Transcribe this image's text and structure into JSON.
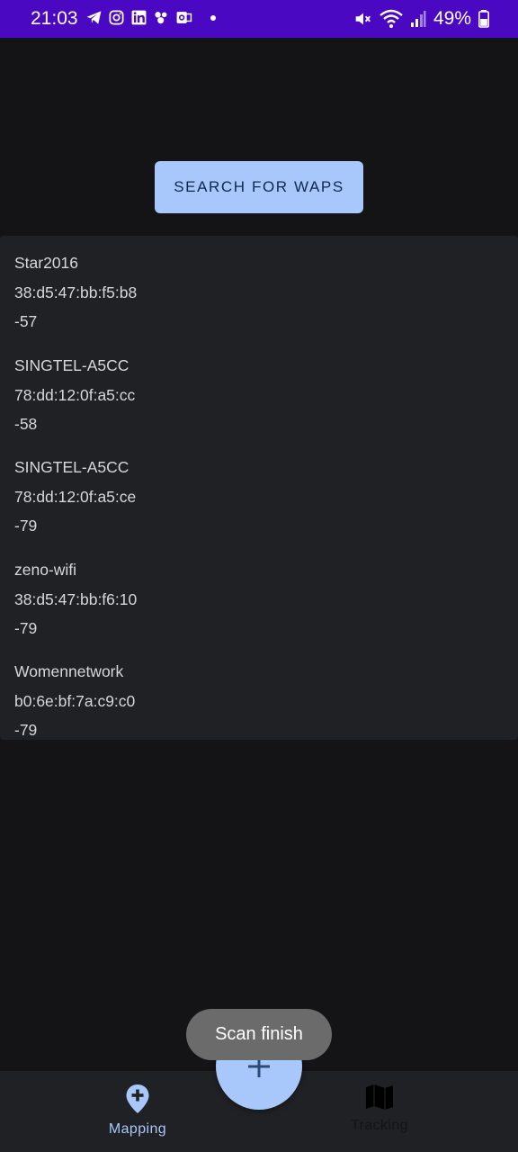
{
  "status_bar": {
    "time": "21:03",
    "battery": "49%",
    "left_icons": [
      "telegram-icon",
      "instagram-icon",
      "linkedin-icon",
      "app-icon",
      "outlook-icon"
    ],
    "right_icons": [
      "mute-icon",
      "wifi-icon",
      "signal-icon",
      "battery-icon"
    ],
    "background": "#4a08c2"
  },
  "search_button": {
    "label": "SEARCH FOR WAPS"
  },
  "waps": [
    {
      "ssid": "Star2016",
      "bssid": "38:d5:47:bb:f5:b8",
      "rssi": "-57"
    },
    {
      "ssid": "SINGTEL-A5CC",
      "bssid": "78:dd:12:0f:a5:cc",
      "rssi": "-58"
    },
    {
      "ssid": "SINGTEL-A5CC",
      "bssid": "78:dd:12:0f:a5:ce",
      "rssi": "-79"
    },
    {
      "ssid": "zeno-wifi",
      "bssid": "38:d5:47:bb:f6:10",
      "rssi": "-79"
    },
    {
      "ssid": "Womennetwork",
      "bssid": "b0:6e:bf:7a:c9:c0",
      "rssi": "-79"
    }
  ],
  "toast": {
    "text": "Scan finish"
  },
  "fab": {
    "icon": "plus-icon"
  },
  "bottom_nav": {
    "items": [
      {
        "label": "Mapping",
        "icon": "map-pin-add-icon",
        "active": true
      },
      {
        "label": "Tracking",
        "icon": "map-icon",
        "active": false
      }
    ]
  },
  "colors": {
    "accent": "#a8c7fa",
    "background": "#141416",
    "surface": "#202124"
  }
}
